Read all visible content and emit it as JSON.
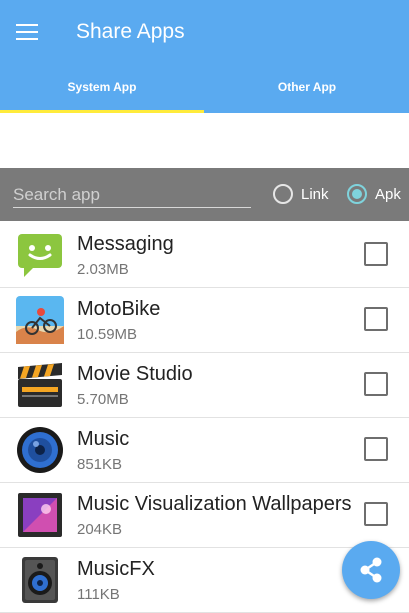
{
  "app": {
    "title": "Share Apps"
  },
  "tabs": [
    {
      "label": "System App",
      "selected": true
    },
    {
      "label": "Other App",
      "selected": false
    }
  ],
  "search": {
    "placeholder": "Search app",
    "value": ""
  },
  "filter": {
    "options": [
      {
        "label": "Link",
        "checked": false
      },
      {
        "label": "Apk",
        "checked": true
      }
    ]
  },
  "apps": [
    {
      "name": "Messaging",
      "size": "2.03MB",
      "icon": "messaging-icon",
      "checked": false
    },
    {
      "name": "MotoBike",
      "size": "10.59MB",
      "icon": "motobike-icon",
      "checked": false
    },
    {
      "name": "Movie Studio",
      "size": "5.70MB",
      "icon": "movie-studio-icon",
      "checked": false
    },
    {
      "name": "Music",
      "size": "851KB",
      "icon": "music-icon",
      "checked": false
    },
    {
      "name": "Music Visualization Wallpapers",
      "size": "204KB",
      "icon": "music-visualization-icon",
      "checked": false
    },
    {
      "name": "MusicFX",
      "size": "111KB",
      "icon": "musicfx-icon",
      "checked": false
    }
  ],
  "colors": {
    "primary": "#5aaaf0",
    "indicator": "#ffeb3b",
    "search_bar": "#7a7a7a",
    "radio_accent": "#7fd3dc"
  },
  "fab": {
    "icon": "share-icon"
  }
}
